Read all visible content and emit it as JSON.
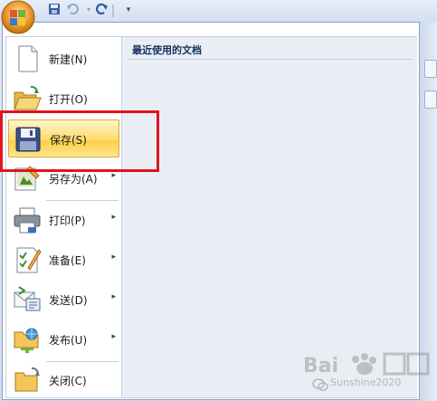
{
  "menu": {
    "recent_title": "最近使用的文档",
    "items": [
      {
        "label": "新建(N)",
        "has_submenu": false
      },
      {
        "label": "打开(O)",
        "has_submenu": false
      },
      {
        "label": "保存(S)",
        "has_submenu": false
      },
      {
        "label": "另存为(A)",
        "has_submenu": true
      },
      {
        "label": "打印(P)",
        "has_submenu": true
      },
      {
        "label": "准备(E)",
        "has_submenu": true
      },
      {
        "label": "发送(D)",
        "has_submenu": true
      },
      {
        "label": "发布(U)",
        "has_submenu": true
      },
      {
        "label": "关闭(C)",
        "has_submenu": false
      }
    ],
    "submenu_arrow": "▸"
  },
  "qat": {
    "icons": [
      "office-logo-icon",
      "save-icon",
      "undo-icon",
      "redo-icon",
      "customize-icon"
    ],
    "customize_glyph": "▾"
  },
  "watermark": {
    "text": "Sunshine2020"
  },
  "colors": {
    "highlight": "#e0141c",
    "selected_item": "#ffd96a",
    "accent": "#15325e"
  }
}
